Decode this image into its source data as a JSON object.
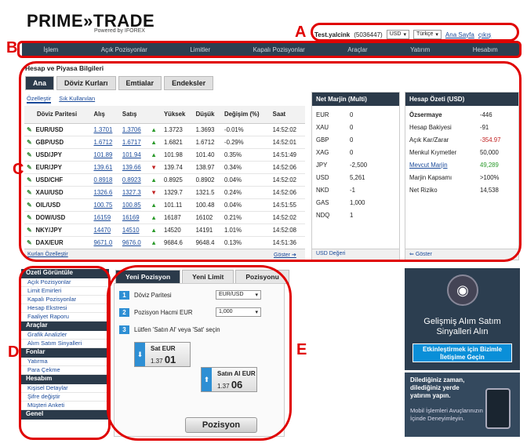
{
  "header": {
    "logo": "PRIME»TRADE",
    "logo_sub": "Powered by IFOREX",
    "username": "Test.yalcink",
    "account_id": "(5036447)",
    "currency": "USD",
    "language": "Türkçe",
    "home_link": "Ana Sayfa",
    "logout_link": "çıkış"
  },
  "nav": [
    "İşlem",
    "Açık Pozisyonlar",
    "Limitler",
    "Kapalı Pozisyonlar",
    "Araçlar",
    "Yatırım",
    "Hesabım"
  ],
  "market": {
    "title": "Hesap ve Piyasa Bilgileri",
    "tabs": [
      "Ana",
      "Döviz Kurları",
      "Emtialar",
      "Endeksler"
    ],
    "subtabs": [
      "Özelleştir",
      "Sık Kullanılan"
    ],
    "columns": [
      "Döviz Paritesi",
      "Alış",
      "Satış",
      "",
      "Yüksek",
      "Düşük",
      "Değişim (%)",
      "Saat"
    ],
    "rows": [
      {
        "sym": "EUR/USD",
        "buy": "1.3701",
        "sell": "1.3706",
        "dir": "up",
        "high": "1.3723",
        "low": "1.3693",
        "chg": "-0.01%",
        "time": "14:52:02"
      },
      {
        "sym": "GBP/USD",
        "buy": "1.6712",
        "sell": "1.6717",
        "dir": "up",
        "high": "1.6821",
        "low": "1.6712",
        "chg": "-0.29%",
        "time": "14:52:01"
      },
      {
        "sym": "USD/JPY",
        "buy": "101.89",
        "sell": "101.94",
        "dir": "up",
        "high": "101.98",
        "low": "101.40",
        "chg": "0.35%",
        "time": "14:51:49"
      },
      {
        "sym": "EUR/JPY",
        "buy": "139.61",
        "sell": "139.66",
        "dir": "down",
        "high": "139.74",
        "low": "138.97",
        "chg": "0.34%",
        "time": "14:52:06"
      },
      {
        "sym": "USD/CHF",
        "buy": "0.8918",
        "sell": "0.8923",
        "dir": "up",
        "high": "0.8925",
        "low": "0.8902",
        "chg": "0.04%",
        "time": "14:52:02"
      },
      {
        "sym": "XAU/USD",
        "buy": "1326.6",
        "sell": "1327.3",
        "dir": "down",
        "high": "1329.7",
        "low": "1321.5",
        "chg": "0.24%",
        "time": "14:52:06"
      },
      {
        "sym": "OIL/USD",
        "buy": "100.75",
        "sell": "100.85",
        "dir": "up",
        "high": "101.11",
        "low": "100.48",
        "chg": "0.04%",
        "time": "14:51:55"
      },
      {
        "sym": "DOW/USD",
        "buy": "16159",
        "sell": "16169",
        "dir": "up",
        "high": "16187",
        "low": "16102",
        "chg": "0.21%",
        "time": "14:52:02"
      },
      {
        "sym": "NKY/JPY",
        "buy": "14470",
        "sell": "14510",
        "dir": "up",
        "high": "14520",
        "low": "14191",
        "chg": "1.01%",
        "time": "14:52:08"
      },
      {
        "sym": "DAX/EUR",
        "buy": "9671.0",
        "sell": "9676.0",
        "dir": "up",
        "high": "9684.6",
        "low": "9648.4",
        "chg": "0.13%",
        "time": "14:51:36"
      }
    ],
    "footer_left": "Kurları Özelleştir",
    "footer_right": "Göster"
  },
  "net_margin": {
    "title": "Net Marjin (Multi)",
    "rows": [
      {
        "k": "EUR",
        "v": "0"
      },
      {
        "k": "XAU",
        "v": "0"
      },
      {
        "k": "GBP",
        "v": "0"
      },
      {
        "k": "XAG",
        "v": "0"
      },
      {
        "k": "JPY",
        "v": "-2,500"
      },
      {
        "k": "USD",
        "v": "5,261"
      },
      {
        "k": "NKD",
        "v": "-1"
      },
      {
        "k": "GAS",
        "v": "1,000"
      },
      {
        "k": "NDQ",
        "v": "1"
      }
    ],
    "footer": "USD Değeri"
  },
  "summary": {
    "title": "Hesap Özeti (USD)",
    "rows": [
      {
        "k": "Özsermaye",
        "v": "-446",
        "bold": true
      },
      {
        "k": "Hesap Bakiyesi",
        "v": "-91"
      },
      {
        "k": "Açık Kar/Zarar",
        "v": "-354.97",
        "color": "#c02020"
      },
      {
        "k": "Menkul Kıymetler",
        "v": "50,000"
      },
      {
        "k": "Mevcut Marjin",
        "v": "49,289",
        "link": true,
        "color": "#2a9a2a"
      },
      {
        "k": "Marjin Kapsamı",
        "v": ">100%"
      },
      {
        "k": "Net Riziko",
        "v": "14,538"
      }
    ],
    "footer": "Göster"
  },
  "sidebar": [
    {
      "type": "head",
      "label": "Özeti Görüntüle"
    },
    {
      "type": "item",
      "label": "Açık Pozisyonlar"
    },
    {
      "type": "item",
      "label": "Limit Emirleri"
    },
    {
      "type": "item",
      "label": "Kapalı Pozisyonlar"
    },
    {
      "type": "item",
      "label": "Hesap Ekstresi"
    },
    {
      "type": "item",
      "label": "Faaliyet Raporu"
    },
    {
      "type": "head",
      "label": "Araçlar"
    },
    {
      "type": "item",
      "label": "Grafik Analizler"
    },
    {
      "type": "item",
      "label": "Alım Satım Sinyalleri"
    },
    {
      "type": "head",
      "label": "Fonlar"
    },
    {
      "type": "item",
      "label": "Yatırma"
    },
    {
      "type": "item",
      "label": "Para Çekme"
    },
    {
      "type": "head",
      "label": "Hesabım"
    },
    {
      "type": "item",
      "label": "Kişisel Detaylar"
    },
    {
      "type": "item",
      "label": "Şifre değiştir"
    },
    {
      "type": "item",
      "label": "Müşteri Anketi"
    },
    {
      "type": "head",
      "label": "Genel"
    }
  ],
  "position": {
    "tabs": [
      "Yeni Pozisyon",
      "Yeni Limit",
      "Pozisyonu"
    ],
    "step1_label": "Döviz Paritesi",
    "step1_value": "EUR/USD",
    "step2_label": "Pozisyon Hacmi EUR",
    "step2_value": "1,000",
    "step3_label": "Lütfen 'Satın Al' veya 'Sat' seçin",
    "sell_label": "Sat EUR",
    "sell_prefix": "1.37",
    "sell_big": "01",
    "buy_label": "Satın Al EUR",
    "buy_prefix": "1.37",
    "buy_big": "06",
    "submit": "Pozisyon"
  },
  "ads": {
    "ad1_title": "Gelişmiş Alım Satım Sinyalleri Alın",
    "ad1_button": "Etkinleştirmek için Bizimle İletişime Geçin",
    "ad2_title": "Dilediğiniz zaman, dilediğiniz yerde yatırım yapın.",
    "ad2_sub": "Mobil İşlemleri Avuçlarınızın İçinde Deneyimleyin."
  },
  "annotations": [
    "A",
    "B",
    "C",
    "D",
    "E"
  ],
  "colors": {
    "accent": "#e00000",
    "nav": "#2c3e50",
    "link": "#1a4a9a",
    "up": "#2a9a2a",
    "down": "#c02020"
  }
}
